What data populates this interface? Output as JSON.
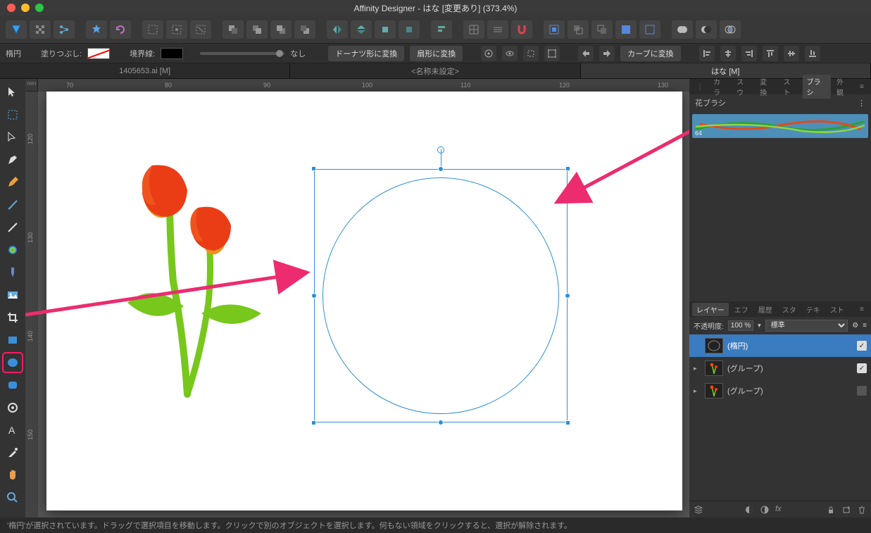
{
  "window": {
    "title": "Affinity Designer - はな [変更あり] (373.4%)"
  },
  "context": {
    "tool_label": "楕円",
    "fill_label": "塗りつぶし:",
    "stroke_label": "境界線:",
    "stroke_style": "なし",
    "btn_donut": "ドーナツ形に変換",
    "btn_pie": "扇形に変換",
    "btn_curve": "カーブに変換"
  },
  "doc_tabs": {
    "t1": "1405653.ai [M]",
    "t2": "<名称未設定>",
    "t3": "はな [M]"
  },
  "ruler": {
    "unit": "mm",
    "h": {
      "v70": "70",
      "v80": "80",
      "v90": "90",
      "v100": "100",
      "v110": "110",
      "v120": "120",
      "v130": "130"
    },
    "v": {
      "v120": "120",
      "v130": "130",
      "v140": "140",
      "v150": "150"
    }
  },
  "right_tabs_top": {
    "color": "カラ",
    "swatch": "スウ",
    "transform": "変換",
    "stroke": "スト",
    "brush": "ブラシ",
    "appearance": "外観"
  },
  "brush_panel": {
    "header": "花ブラシ",
    "item_num": "64"
  },
  "right_tabs_mid": {
    "layers": "レイヤー",
    "effects": "エフ",
    "history": "履歴",
    "styles": "スタ",
    "text": "テキ",
    "stock": "スト"
  },
  "layers": {
    "opacity_label": "不透明度:",
    "opacity_val": "100 %",
    "blend": "標準",
    "row1": "(楕円)",
    "row2": "(グループ)",
    "row3": "(グループ)"
  },
  "status": {
    "text": "'楕円'が選択されています。ドラッグで選択項目を移動します。クリックで別のオブジェクトを選択します。何もない領域をクリックすると、選択が解除されます。"
  }
}
